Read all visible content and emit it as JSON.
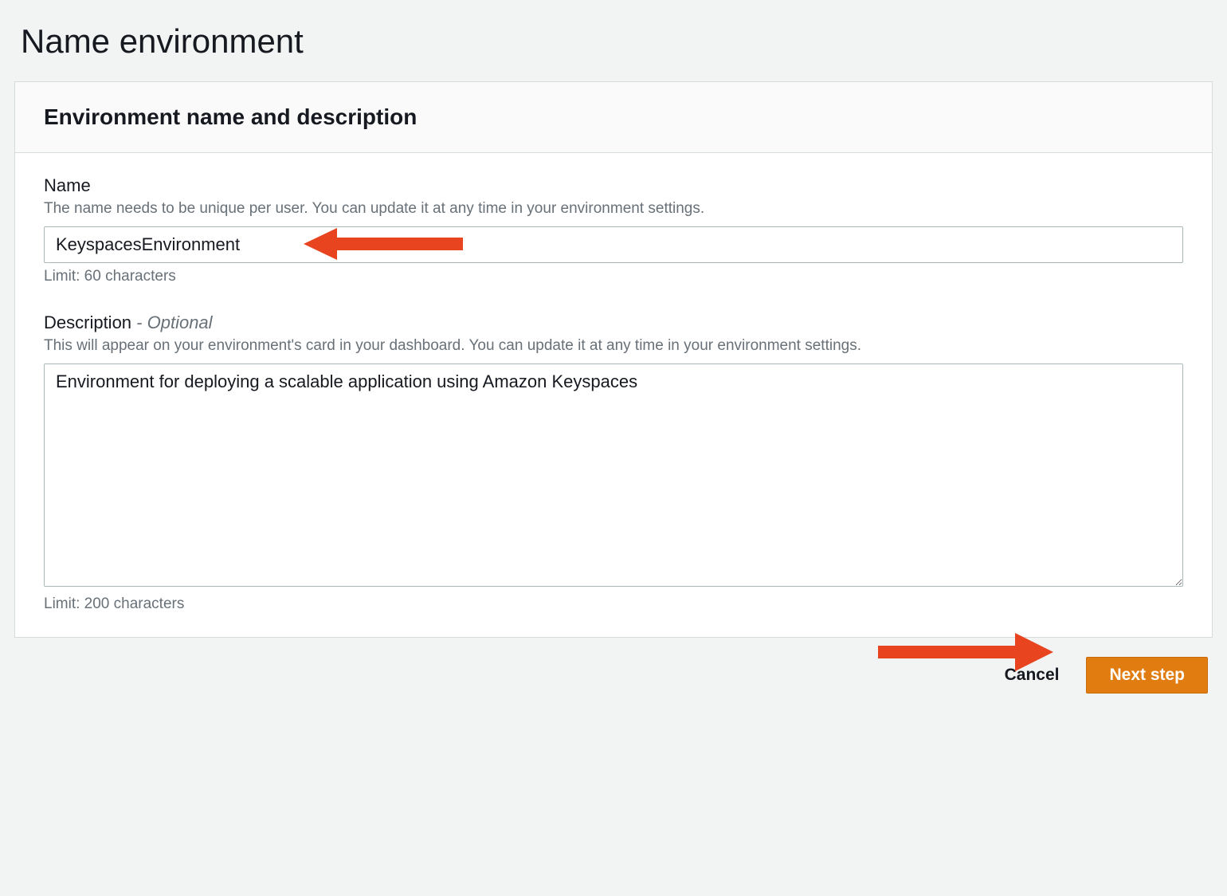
{
  "page": {
    "title": "Name environment"
  },
  "panel": {
    "header": "Environment name and description"
  },
  "nameField": {
    "label": "Name",
    "description": "The name needs to be unique per user. You can update it at any time in your environment settings.",
    "value": "KeyspacesEnvironment",
    "limit": "Limit: 60 characters"
  },
  "descriptionField": {
    "label": "Description",
    "optional": "- Optional",
    "description": "This will appear on your environment's card in your dashboard. You can update it at any time in your environment settings.",
    "value": "Environment for deploying a scalable application using Amazon Keyspaces",
    "limit": "Limit: 200 characters"
  },
  "actions": {
    "cancel": "Cancel",
    "next": "Next step"
  },
  "colors": {
    "arrow": "#e8441f",
    "primaryButton": "#e17c11"
  }
}
